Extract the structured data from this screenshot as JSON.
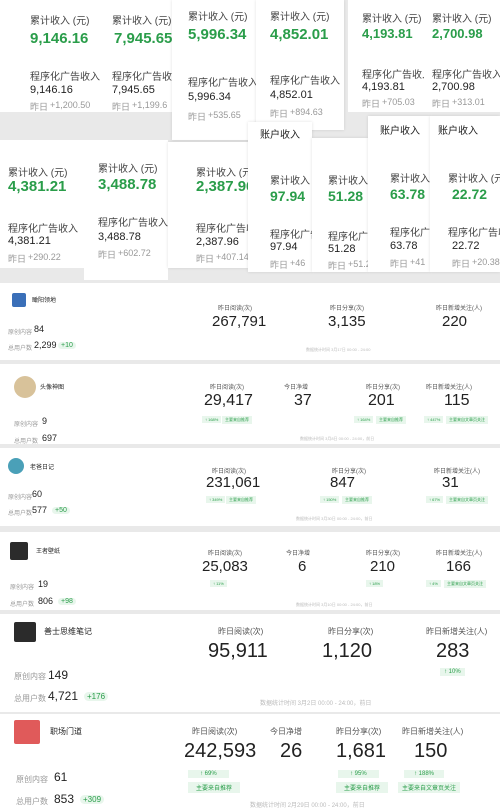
{
  "labels": {
    "cumulative": "累计收入 (元)",
    "program_ad": "程序化广告收入",
    "yesterday_prefix": "昨日",
    "account_income": "账户收入",
    "reads": "昨日阅读(次)",
    "shares": "昨日分享(次)",
    "follows": "昨日新增关注(人)",
    "net_growth": "今日净增",
    "content": "原创内容",
    "followers": "总用户数",
    "mainly_rec": "主要来自推荐",
    "mainly_article": "主要来自文章页关注"
  },
  "top_cards": [
    {
      "total": "9,146.16",
      "ad": "9,146.16",
      "ydelta": "+1,200.50"
    },
    {
      "total": "7,945.65",
      "ad": "7,945.65",
      "ydelta": "+1,199.6"
    },
    {
      "total": "5,996.34",
      "ad": "5,996.34",
      "ydelta": "+535.65"
    },
    {
      "total": "4,852.01",
      "ad": "4,852.01",
      "ydelta": "+894.63"
    },
    {
      "total": "4,193.81",
      "ad": "4,193.81",
      "ydelta": "+705.03"
    },
    {
      "total": "2,700.98",
      "ad": "2,700.98",
      "ydelta": "+313.01"
    }
  ],
  "mid_cards": [
    {
      "total": "4,381.21",
      "ad": "4,381.21",
      "ydelta": "+290.22"
    },
    {
      "total": "3,488.78",
      "ad": "3,488.78",
      "ydelta": "+602.72"
    },
    {
      "total": "2,387.96",
      "ad": "2,387.96",
      "ydelta": "+407.14"
    },
    {
      "total": "97.94",
      "ad": "97.94",
      "ydelta": "+46"
    },
    {
      "total": "51.28",
      "ad": "51.28",
      "ydelta": "+51.2"
    },
    {
      "total": "63.78",
      "ad": "63.78",
      "ydelta": "+41"
    },
    {
      "total": "22.72",
      "ad": "22.72",
      "ydelta": "+20.38"
    }
  ],
  "accounts": [
    {
      "name": "瞰阳领地",
      "content": "84",
      "followers": "2,299",
      "fplus": "+10",
      "reads": "267,791",
      "shares": "3,135",
      "follows": "220",
      "footer": "数据统计时间 3月17日 00:00 - 24:00"
    },
    {
      "name": "头像神图",
      "content": "9",
      "followers": "697",
      "fplus": "",
      "reads": "29,417",
      "net": "37",
      "shares": "201",
      "follows": "115",
      "rtrend": "↑ 168%",
      "strend": "↑ 164%",
      "ftrend": "↑ 447%",
      "footer": "数据统计时间 3月8日 00:00 - 24:00，前日"
    },
    {
      "name": "老爸日记",
      "content": "60",
      "followers": "577",
      "fplus": "+50",
      "reads": "231,061",
      "shares": "847",
      "follows": "31",
      "rtrend": "↑ 349%",
      "strend": "↑ 150%",
      "ftrend": "↑ 67%",
      "footer": "数据统计时间 3月30日 00:00 - 24:00，前日"
    },
    {
      "name": "王者壁纸",
      "content": "19",
      "followers": "806",
      "fplus": "+98",
      "reads": "25,083",
      "net": "6",
      "shares": "210",
      "follows": "166",
      "rtrend": "↑ 11%",
      "strend": "↑ 18%",
      "ftrend": "↑ 4%",
      "footer": "数据统计时间 3月10日 00:00 - 24:00，前日"
    },
    {
      "name": "善士思维笔记",
      "content": "149",
      "followers": "4,721",
      "fplus": "+176",
      "reads": "95,911",
      "shares": "1,120",
      "follows": "283",
      "ftrend": "↑ 10%",
      "footer": "数据统计时间 3月2日 00:00 - 24:00，前日"
    },
    {
      "name": "职场门道",
      "content": "61",
      "followers": "853",
      "fplus": "+309",
      "reads": "242,593",
      "net": "26",
      "shares": "1,681",
      "follows": "150",
      "rtrend": "↑ 69%",
      "strend": "↑ 95%",
      "ftrend": "↑ 188%",
      "footer": "数据统计时间 2月29日 00:00 - 24:00，前日"
    }
  ],
  "colors": {
    "green": "#2a9d4a",
    "green_bg": "#e8f6ec"
  }
}
